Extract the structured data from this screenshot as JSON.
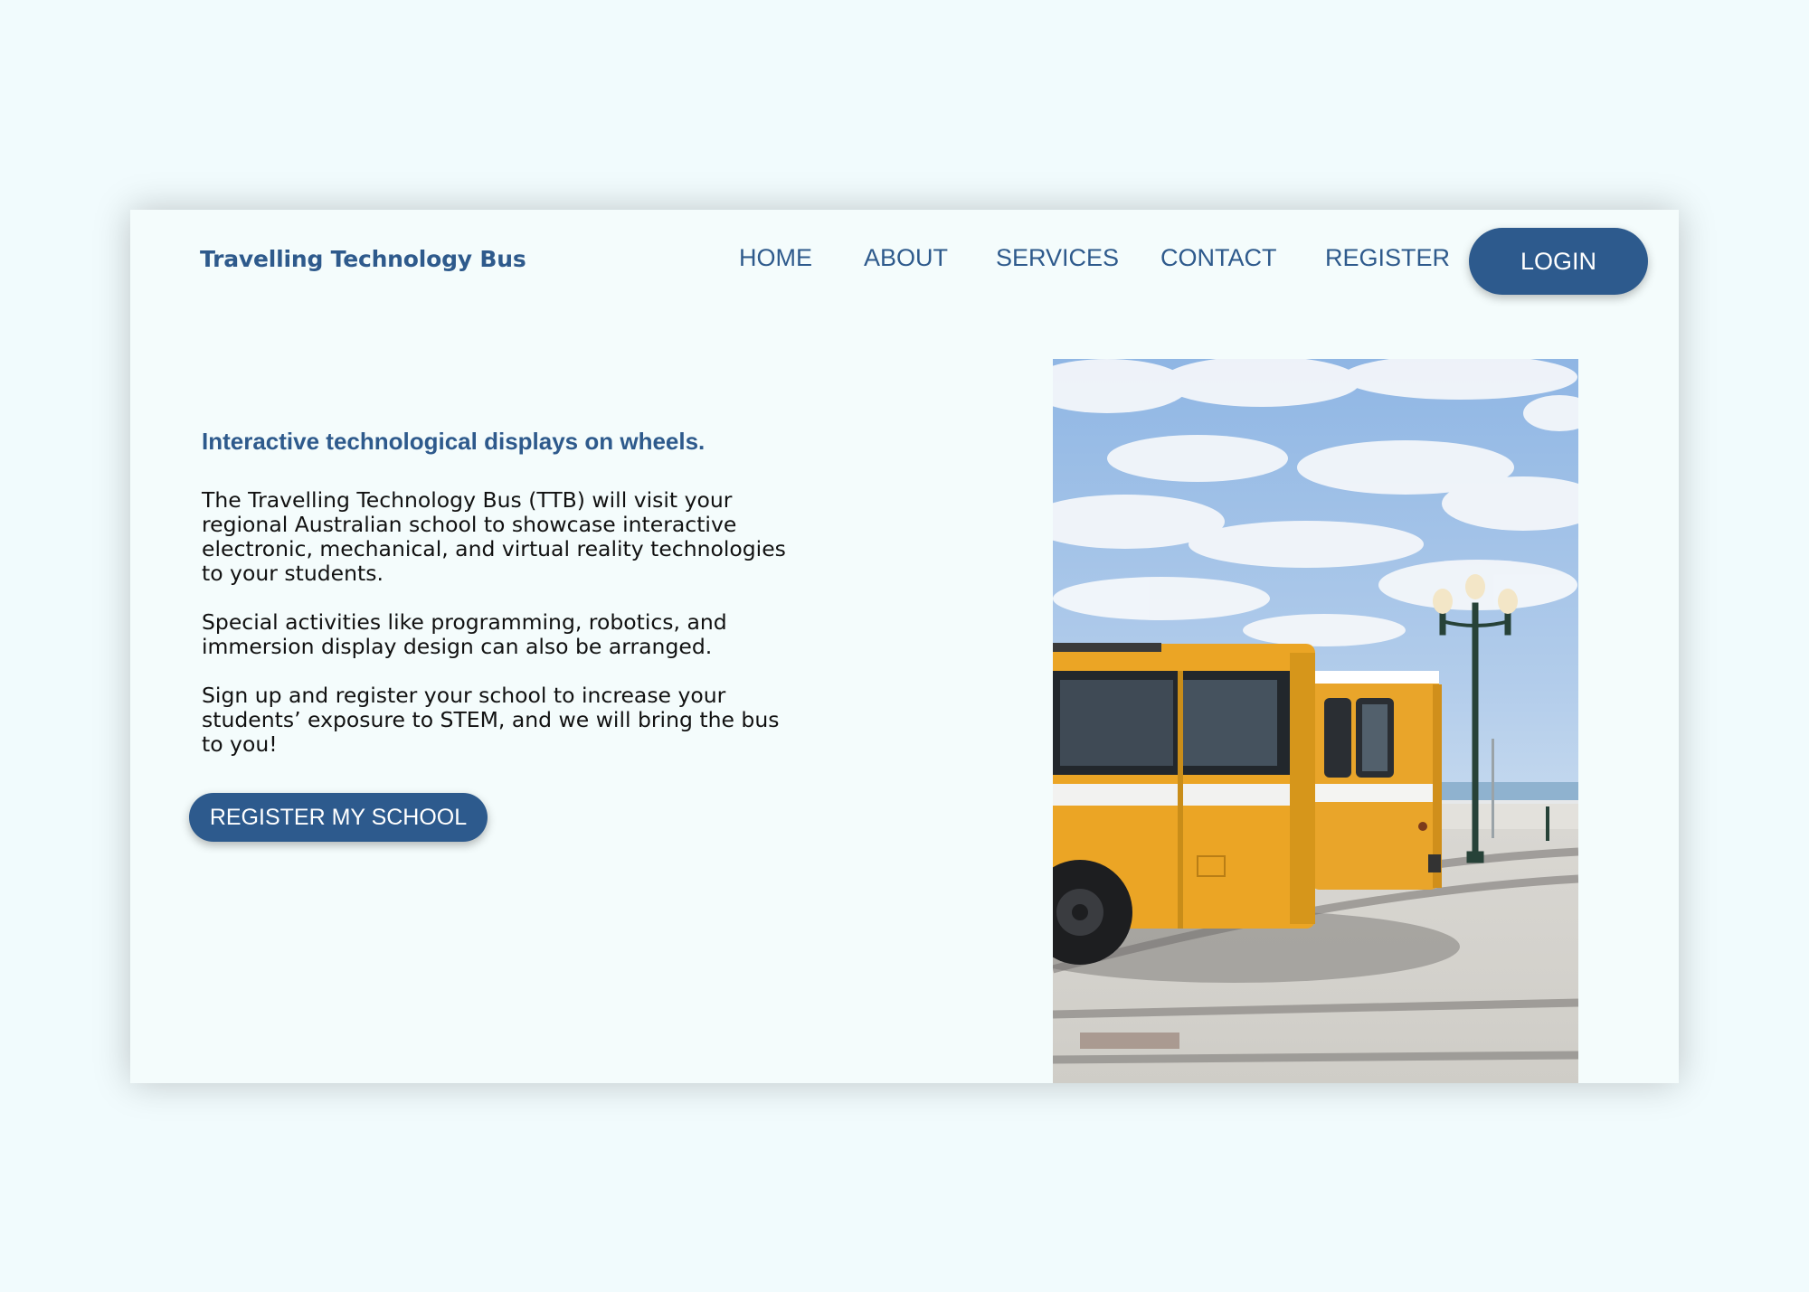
{
  "header": {
    "brand": "Travelling Technology Bus",
    "nav": [
      {
        "label": "HOME"
      },
      {
        "label": "ABOUT"
      },
      {
        "label": "SERVICES"
      },
      {
        "label": "CONTACT"
      },
      {
        "label": "REGISTER"
      }
    ],
    "login_label": "LOGIN"
  },
  "hero": {
    "tagline": "Interactive technological displays on wheels.",
    "paragraph_1": [
      "The Travelling Technology Bus (TTB) will visit your",
      "regional Australian school to showcase interactive",
      "electronic, mechanical, and virtual reality technologies",
      "to your students."
    ],
    "paragraph_2": [
      "Special activities like programming, robotics, and",
      "immersion display design can also be arranged."
    ],
    "paragraph_3": [
      "Sign up and register your school to increase your",
      "students’ exposure to STEM, and we will bring the bus",
      "to you!"
    ],
    "cta_label": "REGISTER MY SCHOOL"
  },
  "image": {
    "subject": "yellow-buses-photo"
  },
  "colors": {
    "page_background": "#f1fbfd",
    "panel_background": "#f4fcfc",
    "brand_blue": "#2d5a8d",
    "body_text": "#111111"
  }
}
